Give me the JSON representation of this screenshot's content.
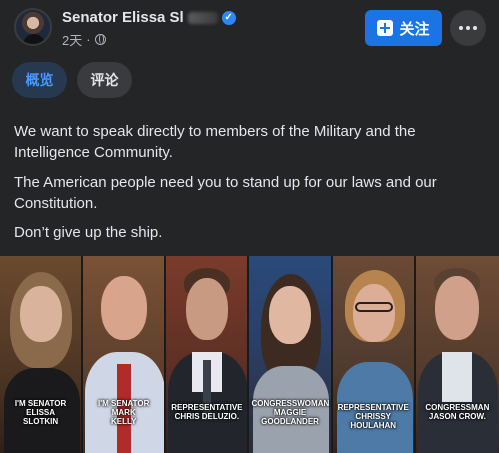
{
  "post": {
    "author": "Senator Elissa Sl",
    "time": "2天",
    "follow_label": "关注",
    "tabs": [
      {
        "label": "概览"
      },
      {
        "label": "评论"
      }
    ],
    "paragraphs": [
      "We want to speak directly to members of the Military and the Intelligence Community.",
      "The American people need you to stand up for our laws and our Constitution.",
      "Don’t give up the ship."
    ],
    "panels": [
      {
        "caption_lines": [
          "I'M SENATOR ELISSA",
          "SLOTKIN"
        ]
      },
      {
        "caption_lines": [
          "I'M SENATOR MARK",
          "KELLY"
        ]
      },
      {
        "caption_lines": [
          "REPRESENTATIVE",
          "CHRIS DELUZIO."
        ]
      },
      {
        "caption_lines": [
          "CONGRESSWOMAN",
          "MAGGIE GOODLANDER"
        ]
      },
      {
        "caption_lines": [
          "REPRESENTATIVE",
          "CHRISSY HOULAHAN"
        ]
      },
      {
        "caption_lines": [
          "CONGRESSMAN",
          "JASON CROW."
        ]
      }
    ]
  },
  "colors": {
    "background": "#242526",
    "accent": "#1b74e4",
    "tab_active_bg": "#263951",
    "tab_active_text": "#4599ff"
  },
  "icons": [
    "verified-badge-icon",
    "globe-icon",
    "follow-plus-icon",
    "more-dots-icon"
  ]
}
